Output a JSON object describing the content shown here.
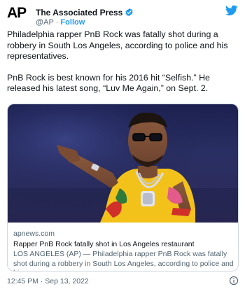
{
  "account": {
    "logo_text": "AP",
    "name": "The Associated Press",
    "handle": "@AP",
    "separator": "·",
    "follow_label": "Follow"
  },
  "tweet": {
    "paragraph1": "Philadelphia rapper PnB Rock was fatally shot during a robbery in South Los Angeles, according to police and his representatives.",
    "paragraph2": "PnB Rock is best known for his 2016 hit “Selfish.” He released his latest song, “Luv Me Again,” on Sept. 2."
  },
  "card": {
    "domain": "apnews.com",
    "title": "Rapper PnB Rock fatally shot in Los Angeles restaurant",
    "description": "LOS ANGELES (AP) — Philadelphia rapper PnB Rock was fatally shot during a robbery in South Los Angeles, according to police and his ..."
  },
  "timestamp": "12:45 PM · Sep 13, 2022",
  "colors": {
    "accent": "#1d9bf0",
    "text": "#0f1419",
    "secondary_text": "#536471",
    "border": "#cfd9de"
  },
  "icons": {
    "verified": "verified-badge-icon",
    "twitter": "twitter-bird-icon",
    "info": "info-icon"
  }
}
